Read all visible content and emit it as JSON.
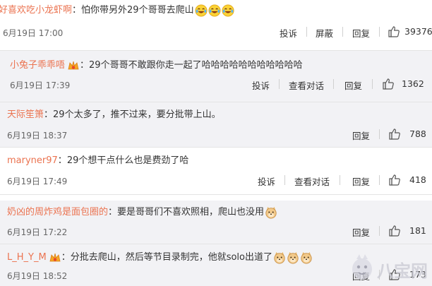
{
  "comments": [
    {
      "user": "好喜欢吃小龙虾啊",
      "text": "怕你带另外29个哥哥去爬山",
      "emoji": [
        "laugh-cry-emoji",
        "laugh-cry-emoji",
        "laugh-cry-emoji"
      ],
      "date": "6月19日 17:00",
      "actions": [
        "投诉",
        "屏蔽",
        "回复"
      ],
      "likes": "39376"
    },
    {
      "user": "小兔子乖乖唔",
      "badge": "vip-badge-icon",
      "text": "29个哥哥不敢跟你走一起了哈哈哈哈哈哈哈哈哈哈哈",
      "date": "6月19日 17:39",
      "actions": [
        "投诉",
        "查看对话",
        "回复"
      ],
      "likes": "1362"
    },
    {
      "user": "天际笙箫",
      "text": "29个太多了，推不过来，要分批带上山。",
      "date": "6月19日 18:37",
      "actions": [
        "回复"
      ],
      "likes": "788"
    },
    {
      "user": "maryner97",
      "text": "29个想干点什么也是费劲了哈",
      "date": "6月19日 17:49",
      "actions": [
        "投诉",
        "查看对话",
        "回复"
      ],
      "likes": "418"
    },
    {
      "user": "奶凶的周炸鸡是面包圈的",
      "text": "要是哥哥们不喜欢照相，爬山也没用",
      "emoji": [
        "doge-emoji"
      ],
      "date": "6月19日 17:22",
      "actions": [
        "回复"
      ],
      "likes": "181"
    },
    {
      "user": "L_H_Y_M",
      "badge": "vip-badge-icon",
      "text": "分批去爬山，然后等节目录制完，他就solo出道了",
      "emoji": [
        "doge-emoji",
        "doge-emoji",
        "doge-emoji"
      ],
      "date": "6月19日 18:52",
      "actions": [
        "回复"
      ],
      "likes": "173"
    }
  ],
  "watermark": "八宝网",
  "colors": {
    "username": "#eb7350",
    "gray_row": "#f2f2f5",
    "text": "#333333"
  }
}
